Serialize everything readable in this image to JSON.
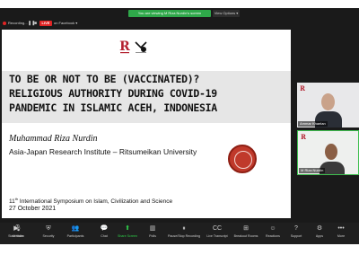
{
  "topbar": {
    "share_banner": "You are viewing M Riza Nurdin's screen",
    "view_options": "View Options ▾"
  },
  "statusbar": {
    "recording": "Recording...",
    "live_badge": "LIVE",
    "live_text": "on Facebook ▾"
  },
  "slide": {
    "title_lines": [
      "TO BE OR NOT TO BE (VACCINATED)?",
      "RELIGIOUS AUTHORITY DURING COVID-19",
      "PANDEMIC IN ISLAMIC ACEH, INDONESIA"
    ],
    "author": "Muhammad Riza Nurdin",
    "affiliation": "Asia-Japan Research Institute – Ritsumeikan University",
    "symposium_sup": "11",
    "symposium_suffix": "th",
    "symposium_rest": " International Symposium on Islam, Civilization and Science",
    "date": "27 October 2021"
  },
  "participants": [
    {
      "name": "Ammar Khaelan"
    },
    {
      "name": "M Riza Nurdin"
    }
  ],
  "toolbar": {
    "items": [
      {
        "label": "Unmute",
        "icon": "mic-icon"
      },
      {
        "label": "Start Video",
        "icon": "video-icon"
      },
      {
        "label": "Security",
        "icon": "shield-icon"
      },
      {
        "label": "Participants",
        "icon": "participants-icon"
      },
      {
        "label": "Chat",
        "icon": "chat-icon"
      },
      {
        "label": "Share Screen",
        "icon": "share-screen-icon"
      },
      {
        "label": "Polls",
        "icon": "polls-icon"
      },
      {
        "label": "Pause/Stop Recording",
        "icon": "record-icon"
      },
      {
        "label": "Live Transcript",
        "icon": "cc-icon"
      },
      {
        "label": "Breakout Rooms",
        "icon": "breakout-icon"
      },
      {
        "label": "Reactions",
        "icon": "reactions-icon"
      },
      {
        "label": "Support",
        "icon": "support-icon"
      },
      {
        "label": "Apps",
        "icon": "apps-icon"
      },
      {
        "label": "More",
        "icon": "more-icon"
      }
    ]
  },
  "colors": {
    "accent_green": "#2fa84a",
    "live_red": "#e02424",
    "brand_red": "#b3202f"
  }
}
